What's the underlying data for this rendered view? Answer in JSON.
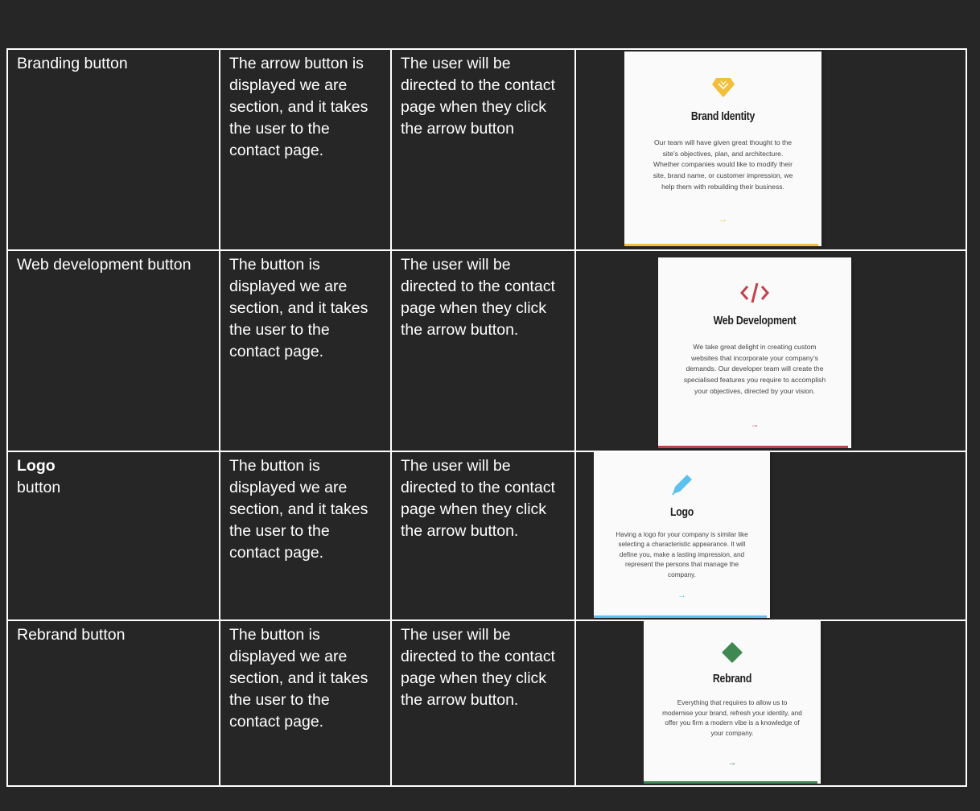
{
  "colors": {
    "brand": "#f2bf3b",
    "web": "#c0434c",
    "logo": "#5cc1ee",
    "rebrand": "#3f8852"
  },
  "rows": [
    {
      "name": "Branding button",
      "description": "The arrow button is displayed we are section, and it takes the user to the contact page.",
      "result": "The user will be directed to the contact page when they click the arrow button",
      "card": {
        "icon": "diamond-gem-icon",
        "title": "Brand Identity",
        "text": "Our team will have given great thought to the site's objectives, plan, and architecture. Whether companies would like to modify their site, brand name, or customer impression, we help them with rebuilding their business.",
        "arrow": "→"
      }
    },
    {
      "name": "Web development button",
      "description": "The button is displayed we are section, and it takes the user to the contact page.",
      "result": "The user will be directed to the contact page when they click the arrow button.",
      "card": {
        "icon": "code-icon",
        "title": "Web Development",
        "text": "We take great delight in creating custom websites that incorporate your company's demands. Our developer team will create the specialised features you require to accomplish your objectives, directed by your vision.",
        "arrow": "→"
      }
    },
    {
      "name_bold": "Logo",
      "name": "button",
      "description": "The button is displayed we are section, and it takes the user to the contact page.",
      "result": "The user will be directed to the contact page when they click the arrow button.",
      "card": {
        "icon": "pen-icon",
        "title": "Logo",
        "text": "Having a logo for your company is similar like selecting a characteristic appearance. It will define you, make a lasting impression, and represent the persons that manage the company.",
        "arrow": "→"
      }
    },
    {
      "name": "Rebrand button",
      "description": "The button is displayed we are section, and it takes the user to the contact page.",
      "result": "The user will be directed to the contact page when they click the arrow button.",
      "card": {
        "icon": "diamond-shape-icon",
        "title": "Rebrand",
        "text": "Everything that requires to allow us to modernise your brand, refresh your identity, and offer you firm a modern vibe is a knowledge of your company.",
        "arrow": "→"
      }
    }
  ]
}
